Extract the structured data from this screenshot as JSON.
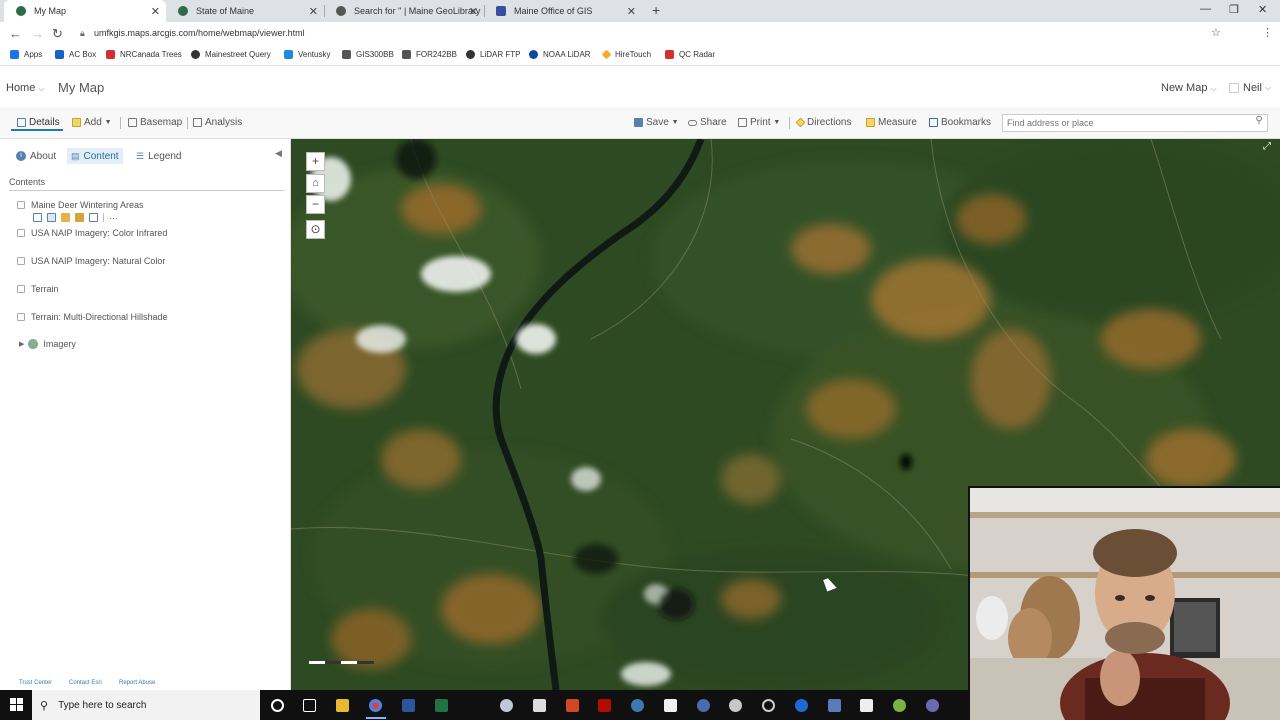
{
  "browser": {
    "tabs": [
      {
        "title": "My Map",
        "active": true
      },
      {
        "title": "State of Maine",
        "active": false
      },
      {
        "title": "Search for '' | Maine GeoLibrary",
        "active": false
      },
      {
        "title": "Maine Office of GIS",
        "active": false
      }
    ],
    "new_tab_icon": "+",
    "url": "umfkgis.maps.arcgis.com/home/webmap/viewer.html",
    "bookmarks": [
      {
        "label": "Apps",
        "color": "#1a73e8"
      },
      {
        "label": "AC Box",
        "color": "#1565c0"
      },
      {
        "label": "NRCanada Trees",
        "color": "#d32f2f"
      },
      {
        "label": "Mainestreet Query",
        "color": "#333333"
      },
      {
        "label": "Ventusky",
        "color": "#1e88e5"
      },
      {
        "label": "GIS300BB",
        "color": "#555555"
      },
      {
        "label": "FOR242BB",
        "color": "#555555"
      },
      {
        "label": "LiDAR FTP",
        "color": "#333333"
      },
      {
        "label": "NOAA LiDAR",
        "color": "#0d47a1"
      },
      {
        "label": "HireTouch",
        "color": "#f9a825"
      },
      {
        "label": "QC Radar",
        "color": "#d32f2f"
      }
    ]
  },
  "header": {
    "home_label": "Home",
    "map_title": "My Map",
    "new_map_label": "New Map",
    "user_label": "Neil"
  },
  "toolbar": {
    "details": "Details",
    "add": "Add",
    "basemap": "Basemap",
    "analysis": "Analysis",
    "save": "Save",
    "share": "Share",
    "print": "Print",
    "directions": "Directions",
    "measure": "Measure",
    "bookmarks": "Bookmarks",
    "search_placeholder": "Find address or place"
  },
  "panel": {
    "tabs": {
      "about": "About",
      "content": "Content",
      "legend": "Legend"
    },
    "contents_label": "Contents",
    "layers": [
      "Maine Deer Wintering Areas",
      "USA NAIP Imagery: Color Infrared",
      "USA NAIP Imagery: Natural Color",
      "Terrain",
      "Terrain: Multi-Directional Hillshade"
    ],
    "basemap_group": "Imagery",
    "footer_links": [
      "Trust Center",
      "Contact Esri",
      "Report Abuse"
    ]
  },
  "taskbar": {
    "search_text": "Type here to search"
  }
}
